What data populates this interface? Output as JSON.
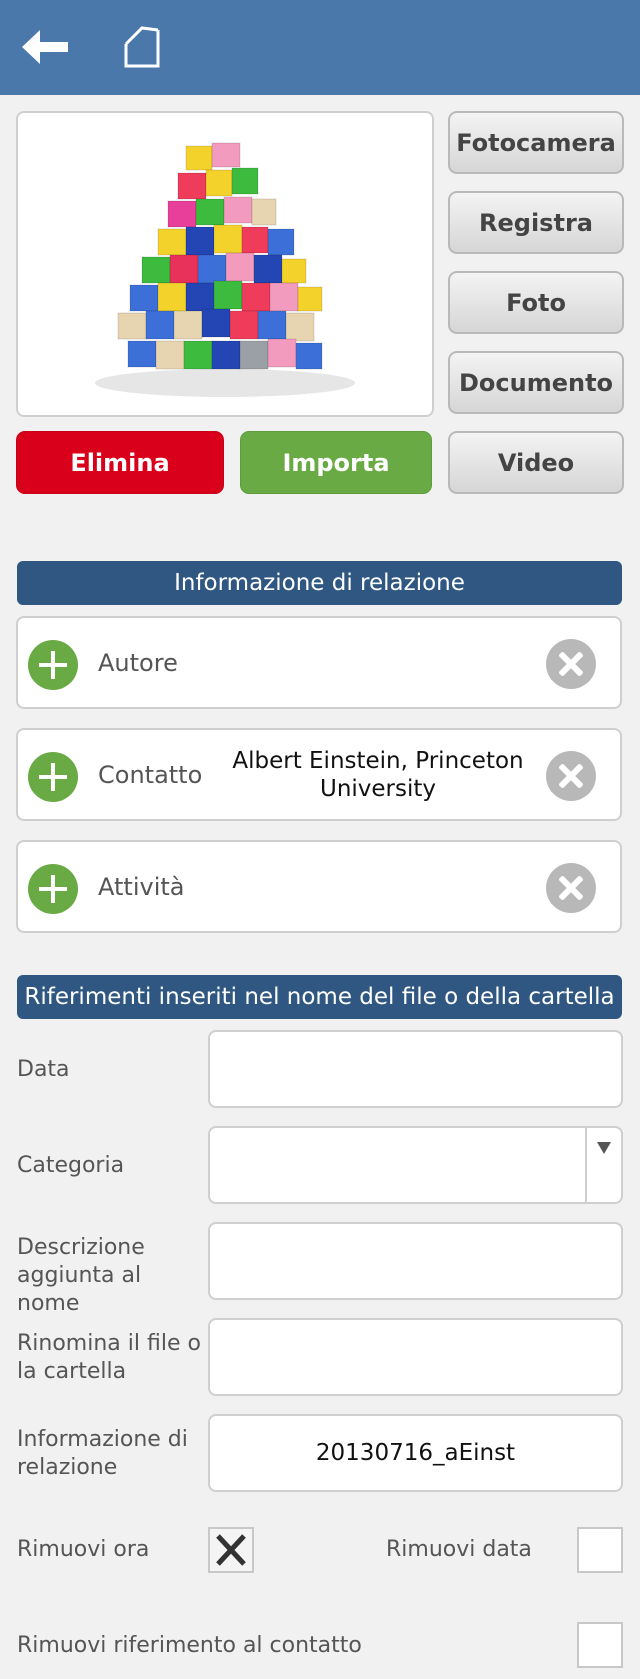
{
  "header": {
    "back_icon": "arrow-left-icon",
    "home_icon": "home-icon",
    "bg_color": "#4a78ab"
  },
  "media": {
    "image_icon": "colored-cubes-image",
    "buttons": {
      "camera": "Fotocamera",
      "record": "Registra",
      "photo": "Foto",
      "document": "Documento",
      "video": "Video",
      "delete": "Elimina",
      "import": "Importa"
    },
    "colors": {
      "delete": "#d9001b",
      "import": "#6aaa45"
    }
  },
  "relations": {
    "header": "Informazione di relazione",
    "rows": [
      {
        "label": "Autore",
        "value": ""
      },
      {
        "label": "Contatto",
        "value": "Albert Einstein, Princeton University"
      },
      {
        "label": "Attività",
        "value": ""
      }
    ]
  },
  "references": {
    "header": "Riferimenti inseriti nel nome del file o della cartella",
    "fields": {
      "date": {
        "label": "Data",
        "value": ""
      },
      "category": {
        "label": "Categoria",
        "value": ""
      },
      "description": {
        "label": "Descrizione aggiunta al nome",
        "value": ""
      },
      "rename": {
        "label": "Rinomina il file o la cartella",
        "value": ""
      },
      "relation_info": {
        "label": "Informazione di relazione",
        "value": "20130716_aEinst"
      }
    },
    "checks": {
      "remove_time": {
        "label": "Rimuovi ora",
        "checked": true
      },
      "remove_date": {
        "label": "Rimuovi data",
        "checked": false
      },
      "remove_contact": {
        "label": "Rimuovi riferimento al contatto",
        "checked": false
      }
    }
  }
}
